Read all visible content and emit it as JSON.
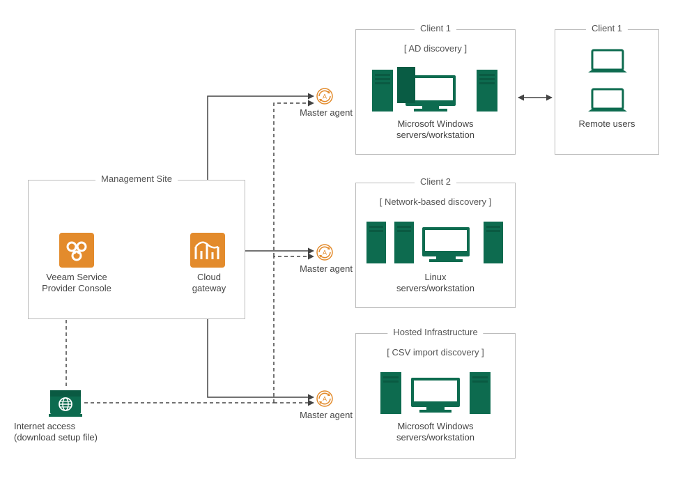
{
  "boxes": {
    "mgmt": {
      "title": "Management Site"
    },
    "client1a": {
      "title": "Client 1",
      "discovery": "[ AD discovery ]",
      "servers": "Microsoft Windows\nservers/workstation"
    },
    "client1b": {
      "title": "Client 1",
      "remote": "Remote users"
    },
    "client2": {
      "title": "Client 2",
      "discovery": "[ Network-based discovery ]",
      "servers": "Linux\nservers/workstation"
    },
    "hosted": {
      "title": "Hosted Infrastructure",
      "discovery": "[ CSV import discovery ]",
      "servers": "Microsoft Windows\nservers/workstation"
    }
  },
  "labels": {
    "vspc": "Veeam Service\nProvider Console",
    "gateway": "Cloud\ngateway",
    "master_agent": "Master agent",
    "internet": "Internet  access\n(download setup file)"
  },
  "colors": {
    "orange": "#e38b2c",
    "green": "#0d6b4f",
    "line": "#444444"
  }
}
